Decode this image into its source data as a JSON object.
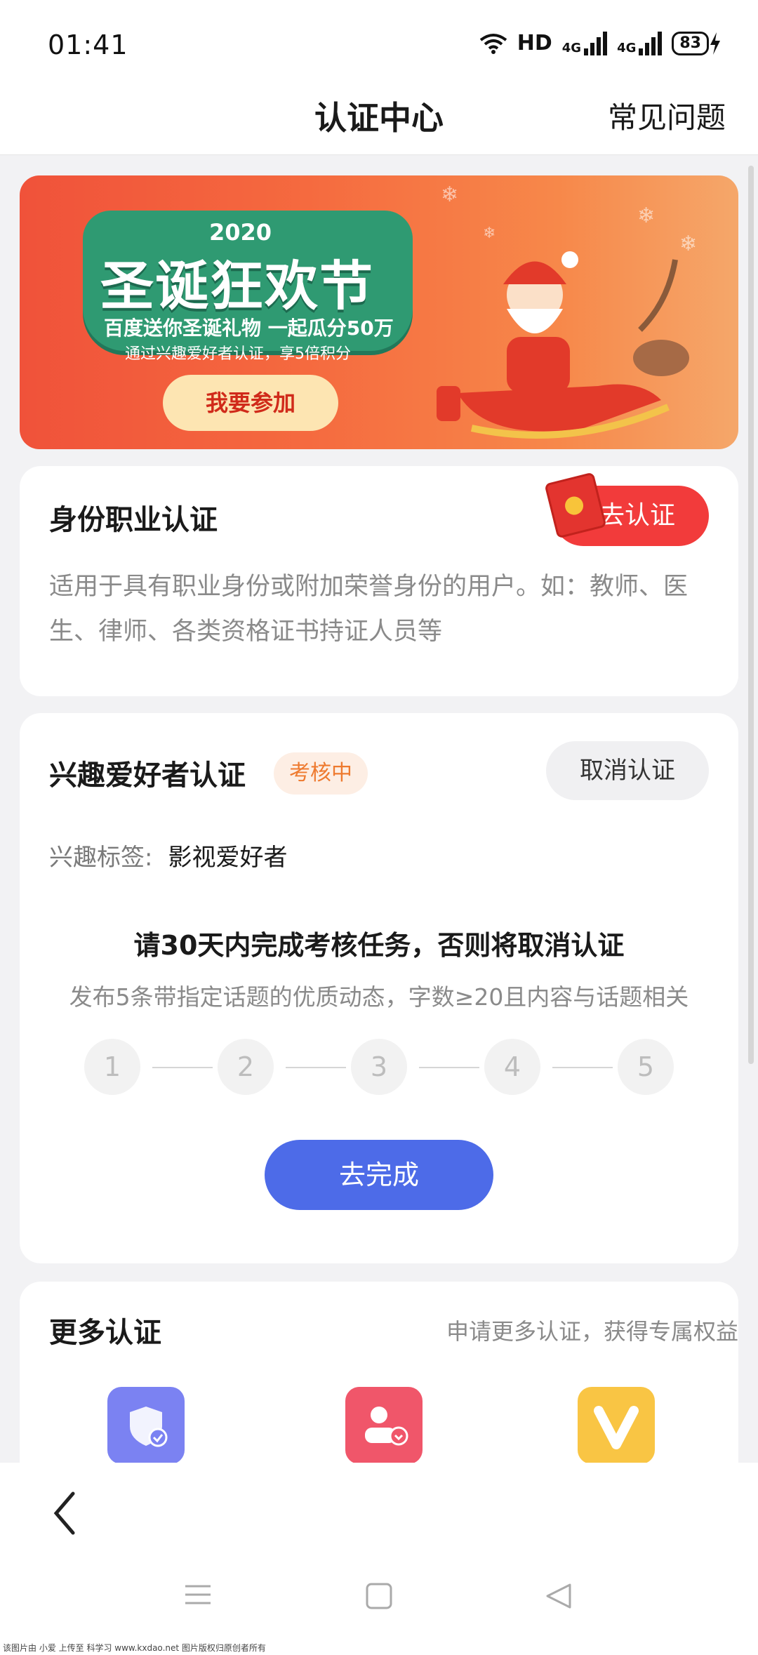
{
  "status_bar": {
    "time": "01:41",
    "hd": "HD",
    "net1": "4G",
    "net2": "4G",
    "battery": "83"
  },
  "nav": {
    "title": "认证中心",
    "faq": "常见问题"
  },
  "banner": {
    "year": "2020",
    "title": "圣诞狂欢节",
    "subtitle1": "百度送你圣诞礼物 一起瓜分50万",
    "subtitle2": "通过兴趣爱好者认证，享5倍积分",
    "button": "我要参加"
  },
  "identity_card": {
    "title": "身份职业认证",
    "button": "去认证",
    "description": "适用于具有职业身份或附加荣誉身份的用户。如：教师、医生、律师、各类资格证书持证人员等"
  },
  "interest_card": {
    "title": "兴趣爱好者认证",
    "status_tag": "考核中",
    "cancel_button": "取消认证",
    "interest_label": "兴趣标签:",
    "interest_value": "影视爱好者",
    "task_title": "请30天内完成考核任务，否则将取消认证",
    "task_desc": "发布5条带指定话题的优质动态，字数≥20且内容与话题相关",
    "steps": [
      "1",
      "2",
      "3",
      "4",
      "5"
    ],
    "complete_button": "去完成"
  },
  "more_card": {
    "title": "更多认证",
    "hint": "申请更多认证，获得专属权益",
    "icons": [
      {
        "name": "shield-check-icon",
        "color": "#7b82f2"
      },
      {
        "name": "user-badge-icon",
        "color": "#f0566a"
      },
      {
        "name": "v-icon",
        "color": "#f9c544"
      }
    ]
  },
  "footer_text": "该图片由 小爱 上传至 科学习 www.kxdao.net 图片版权归原创者所有"
}
